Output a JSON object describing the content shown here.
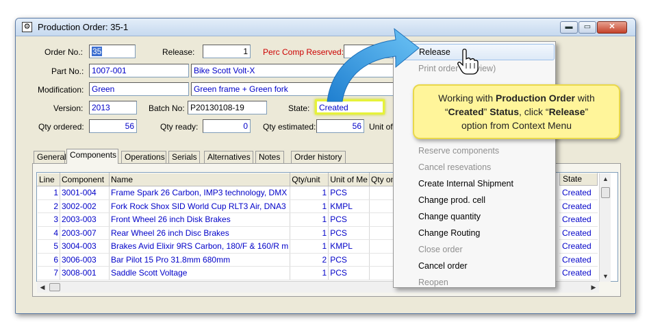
{
  "window": {
    "title": "Production Order: 35-1",
    "min_glyph": "▬",
    "max_glyph": "▭",
    "close_glyph": "✕"
  },
  "header": {
    "order_no_label": "Order No.:",
    "order_no": "35",
    "release_label": "Release:",
    "release": "1",
    "perc_comp_label": "Perc Comp Reserved:",
    "part_no_label": "Part No.:",
    "part_no": "1007-001",
    "part_desc": "Bike Scott Volt-X",
    "modification_label": "Modification:",
    "modification": "Green",
    "modification_desc": "Green frame + Green fork",
    "version_label": "Version:",
    "version": "2013",
    "batch_label": "Batch No:",
    "batch": "P20130108-19",
    "state_label": "State:",
    "state": "Created",
    "qty_ordered_label": "Qty ordered:",
    "qty_ordered": "56",
    "qty_ready_label": "Qty ready:",
    "qty_ready": "0",
    "qty_estimated_label": "Qty estimated:",
    "qty_estimated": "56",
    "unit_label": "Unit of"
  },
  "tabs": [
    "General",
    "Components",
    "Operations",
    "Serials",
    "Alternatives",
    "Notes",
    "Order history"
  ],
  "components": {
    "columns": [
      "Line",
      "Component",
      "Name",
      "Qty/unit",
      "Unit of Me",
      "Qty on c"
    ],
    "state_header": "State",
    "rows": [
      {
        "line": "1",
        "component": "3001-004",
        "name": "Frame Spark 26 Carbon, IMP3 technology, DMX",
        "qty": "1",
        "unit": "PCS",
        "state": "Created"
      },
      {
        "line": "2",
        "component": "3002-002",
        "name": "Fork Rock Shox SID World Cup RLT3 Air, DNA3",
        "qty": "1",
        "unit": "KMPL",
        "state": "Created"
      },
      {
        "line": "3",
        "component": "2003-003",
        "name": "Front Wheel 26 inch Disk Brakes",
        "qty": "1",
        "unit": "PCS",
        "state": "Created"
      },
      {
        "line": "4",
        "component": "2003-007",
        "name": "Rear Wheel 26 inch Disc Brakes",
        "qty": "1",
        "unit": "PCS",
        "state": "Created"
      },
      {
        "line": "5",
        "component": "3004-003",
        "name": "Brakes Avid Elixir 9RS Carbon, 180/F & 160/R m",
        "qty": "1",
        "unit": "KMPL",
        "state": "Created"
      },
      {
        "line": "6",
        "component": "3006-003",
        "name": "Bar Pilot 15 Pro 31.8mm 680mm",
        "qty": "2",
        "unit": "PCS",
        "state": "Created"
      },
      {
        "line": "7",
        "component": "3008-001",
        "name": "Saddle Scott Voltage",
        "qty": "1",
        "unit": "PCS",
        "state": "Created"
      }
    ]
  },
  "context_menu": [
    {
      "label": "Release",
      "disabled": false
    },
    {
      "label": "Print order (preview)",
      "disabled": true
    },
    {
      "label": "",
      "disabled": true
    },
    {
      "label": "",
      "disabled": true
    },
    {
      "label": "",
      "disabled": true
    },
    {
      "label": "",
      "disabled": true
    },
    {
      "label": "Reserve components",
      "disabled": true
    },
    {
      "label": "Cancel resevations",
      "disabled": true
    },
    {
      "label": "Create Internal Shipment",
      "disabled": false
    },
    {
      "label": "Change prod. cell",
      "disabled": false
    },
    {
      "label": "Change quantity",
      "disabled": false
    },
    {
      "label": "Change Routing",
      "disabled": false
    },
    {
      "label": "Close order",
      "disabled": true
    },
    {
      "label": "Cancel order",
      "disabled": false
    },
    {
      "label": "Reopen",
      "disabled": true
    }
  ],
  "callout": {
    "line1_a": "Working with ",
    "line1_b": "Production Order",
    "line1_c": " with",
    "line2_a": "“",
    "line2_b": "Created",
    "line2_c": "” ",
    "line2_d": "Status",
    "line2_e": ", click “",
    "line2_f": "Release",
    "line2_g": "”",
    "line3": "option from Context Menu"
  },
  "colors": {
    "accent": "#3c6fd0",
    "callout_bg": "#fff59a",
    "arrow": "#3aa0e6",
    "state_highlight": "#e6f23a"
  }
}
